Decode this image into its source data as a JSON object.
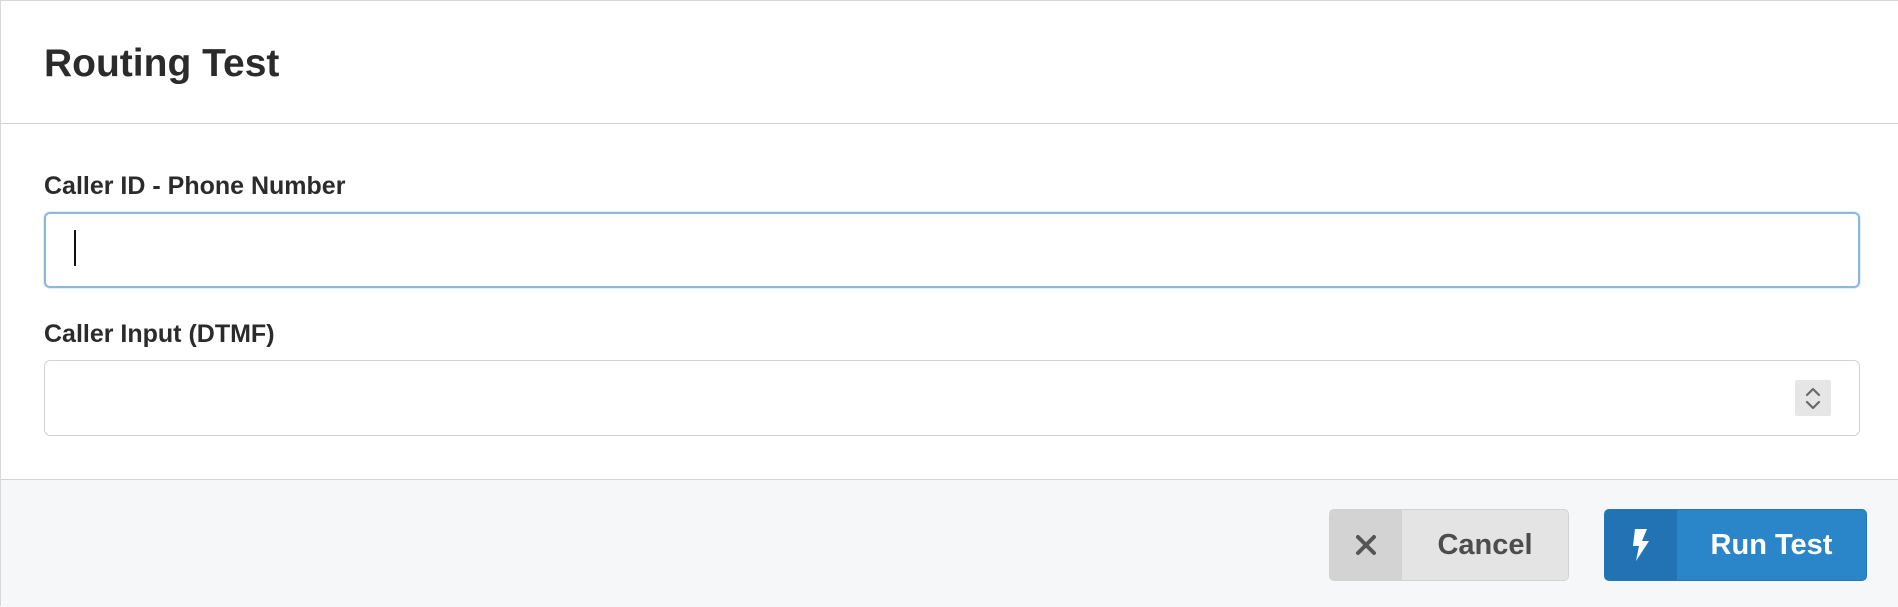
{
  "dialog": {
    "title": "Routing Test"
  },
  "fields": {
    "caller_id": {
      "label": "Caller ID - Phone Number",
      "value": "",
      "placeholder": ""
    },
    "caller_input": {
      "label": "Caller Input (DTMF)",
      "value": "",
      "placeholder": ""
    }
  },
  "footer": {
    "cancel_label": "Cancel",
    "cancel_icon": "close-icon",
    "run_label": "Run Test",
    "run_icon": "lightning-icon"
  },
  "colors": {
    "primary": "#2b86c9",
    "primary_dark": "#2273b3",
    "focus_border": "#8db8da",
    "secondary_button": "#e4e4e4"
  }
}
